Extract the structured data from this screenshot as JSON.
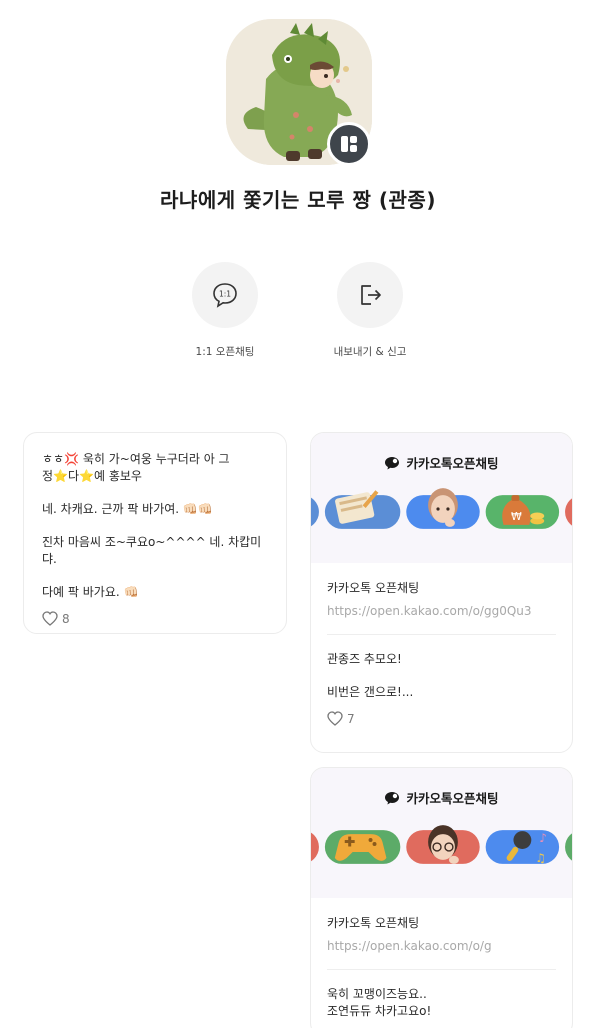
{
  "profile": {
    "name": "라냐에게 쫓기는 모루 짱 (관종)"
  },
  "actions": [
    {
      "label": "1:1 오픈채팅",
      "icon": "speech-bubble-icon",
      "icon_text": "1:1"
    },
    {
      "label": "내보내기 & 신고",
      "icon": "export-icon"
    }
  ],
  "post": {
    "lines": [
      "ㅎㅎ💢 욱히 가~여웅 누구더라 아 그",
      "정⭐다⭐예 홍보우",
      "",
      "네. 차캐요. 근까 팍 바가여. 👊🏻👊🏻",
      "",
      "진차 마음씨 조~쿠요o~^^^^ 네. 차캅미댜.",
      "",
      "다예 팍 바가요. 👊🏻"
    ],
    "likes": "8"
  },
  "open_chat_cards": [
    {
      "brand": "카카오톡오픈채팅",
      "title": "카카오톡 오픈채팅",
      "url": "https://open.kakao.com/o/gg0Qu3",
      "text": [
        "관종즈 추모오!",
        "",
        "비번은 갠으로!..."
      ],
      "likes": "7",
      "pills": [
        {
          "color": "#5b8ed6",
          "icon": "notebook-icon"
        },
        {
          "color": "#4d8bee",
          "icon": "thinking-person-icon"
        },
        {
          "color": "#58b46a",
          "icon": "money-bag-icon"
        }
      ]
    },
    {
      "brand": "카카오톡오픈채팅",
      "title": "카카오톡 오픈채팅",
      "url": "https://open.kakao.com/o/g",
      "text": [
        "욱히 꼬맹이즈능요..",
        "조연듀듀 차카고요o!"
      ],
      "pills": [
        {
          "color": "#5cab68",
          "icon": "game-controller-icon"
        },
        {
          "color": "#e06b5e",
          "icon": "glasses-person-icon"
        },
        {
          "color": "#4d8bee",
          "icon": "microphone-icon"
        }
      ]
    }
  ],
  "colors": {
    "badge": "#3f454c",
    "circle_bg": "#f3f3f3",
    "card_border": "#ececec",
    "url_gray": "#a8a8a8"
  }
}
